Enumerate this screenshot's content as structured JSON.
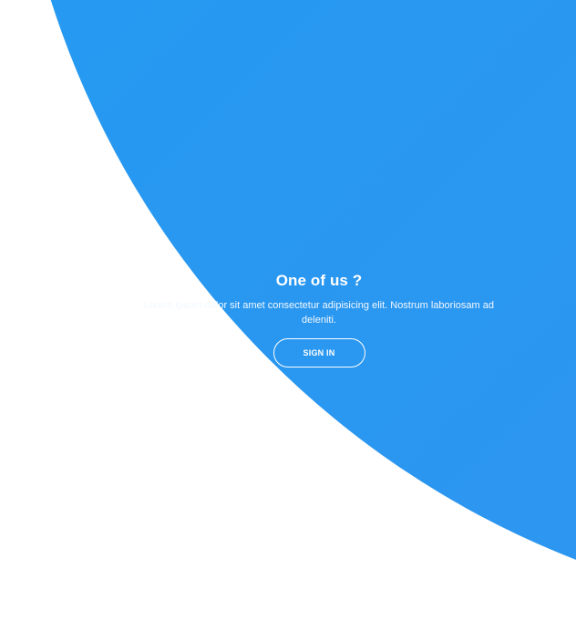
{
  "panel": {
    "title": "One of us ?",
    "text": "Lorem ipsum dolor sit amet consectetur adipisicing elit. Nostrum laboriosam ad deleniti.",
    "button_label": "SIGN IN"
  },
  "colors": {
    "gradient_start": "#1ca7f5",
    "gradient_end": "#3593ee",
    "text": "#ffffff",
    "background": "#ffffff"
  }
}
